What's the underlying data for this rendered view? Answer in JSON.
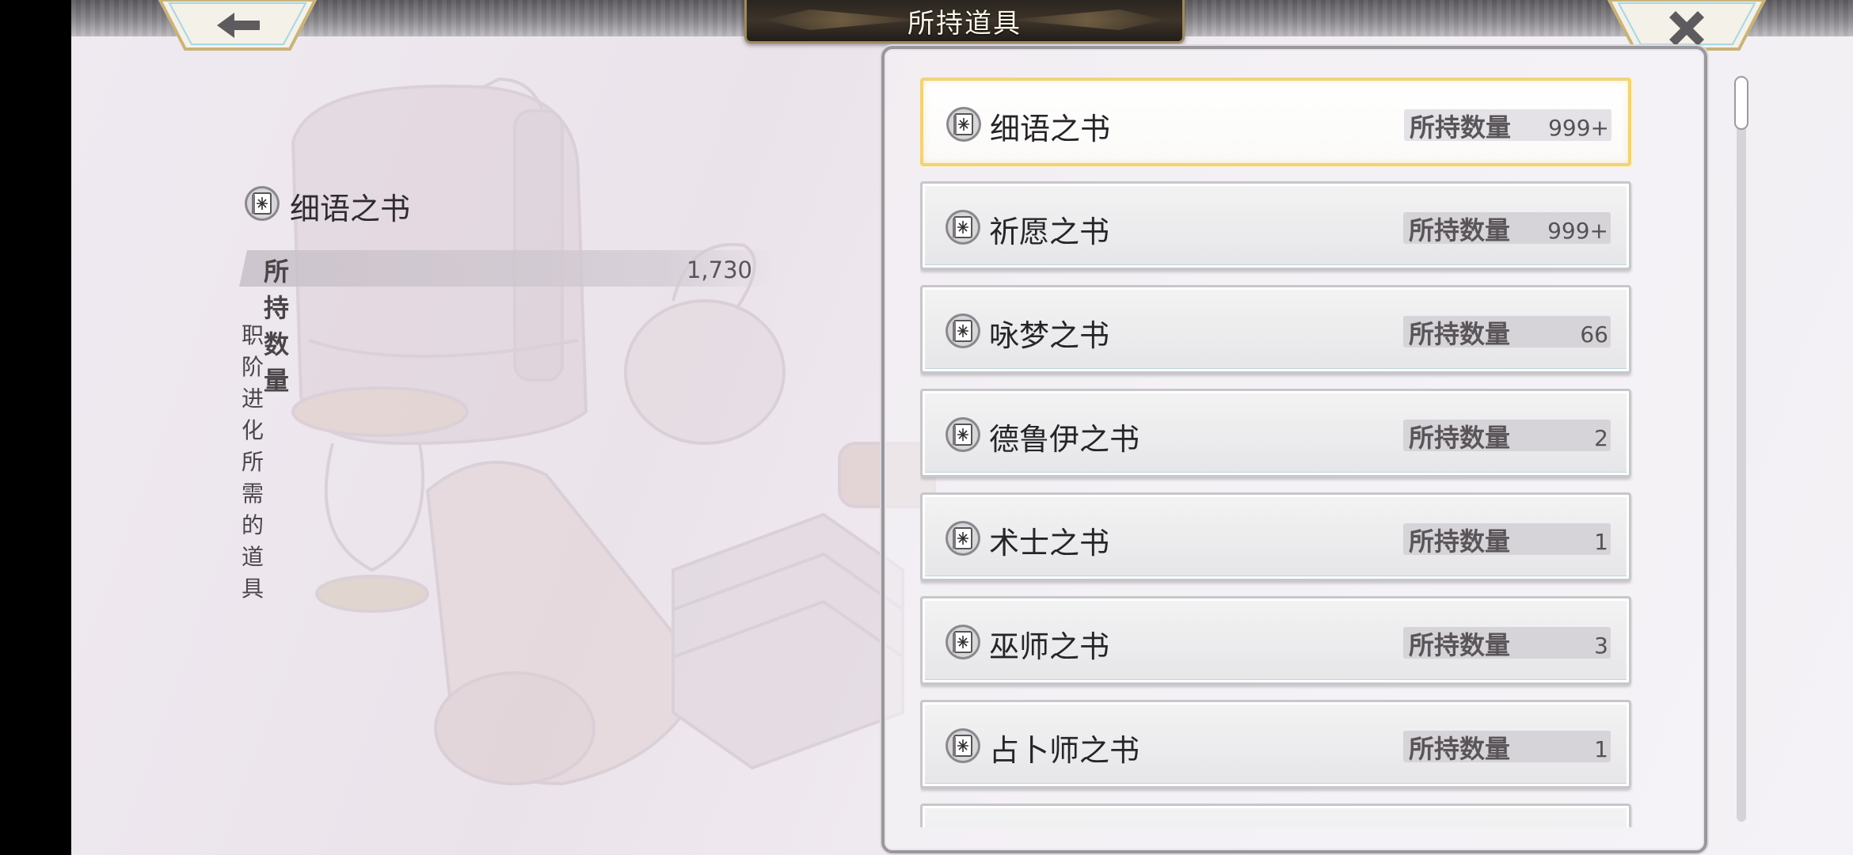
{
  "header": {
    "title": "所持道具",
    "back_icon": "arrow-left-icon",
    "close_icon": "close-icon"
  },
  "detail": {
    "icon": "book-icon",
    "name": "细语之书",
    "qty_label": "所持数量",
    "qty_value": "1,730",
    "description": "职阶进化所需的道具"
  },
  "items": [
    {
      "name": "细语之书",
      "qty_label": "所持数量",
      "qty": "999+",
      "selected": true
    },
    {
      "name": "祈愿之书",
      "qty_label": "所持数量",
      "qty": "999+"
    },
    {
      "name": "咏梦之书",
      "qty_label": "所持数量",
      "qty": "66"
    },
    {
      "name": "德鲁伊之书",
      "qty_label": "所持数量",
      "qty": "2"
    },
    {
      "name": "术士之书",
      "qty_label": "所持数量",
      "qty": "1"
    },
    {
      "name": "巫师之书",
      "qty_label": "所持数量",
      "qty": "3"
    },
    {
      "name": "占卜师之书",
      "qty_label": "所持数量",
      "qty": "1"
    }
  ],
  "colors": {
    "selected_border": "#f0d37a",
    "title_plate": "#2a2520",
    "frame_gold": "#c9b37a"
  }
}
